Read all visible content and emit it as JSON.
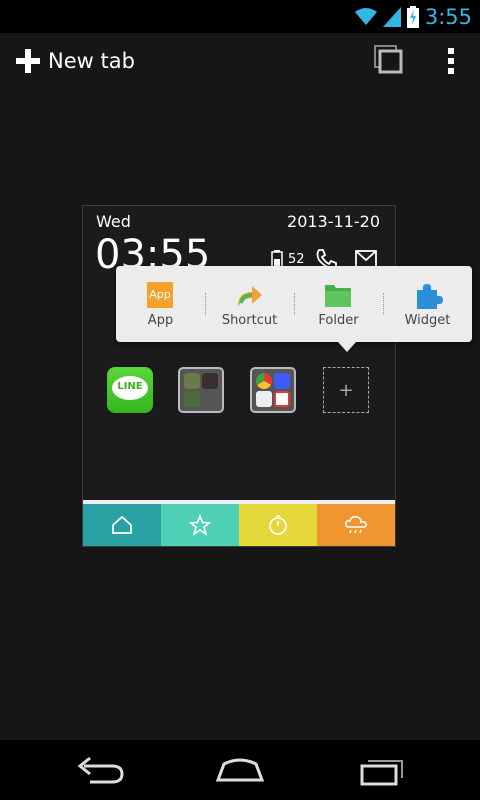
{
  "status_bar": {
    "time": "3:55"
  },
  "action_bar": {
    "new_tab_label": "New tab"
  },
  "preview": {
    "day": "Wed",
    "date": "2013-11-20",
    "clock": "03:55",
    "battery_level": "52",
    "line_app_label": "LINE",
    "dock_colors": [
      "#2aa1a5",
      "#4fd1b8",
      "#e6d83a",
      "#ef9630"
    ]
  },
  "add_menu": {
    "options": [
      {
        "label": "App",
        "icon_text": "App"
      },
      {
        "label": "Shortcut"
      },
      {
        "label": "Folder"
      },
      {
        "label": "Widget"
      }
    ]
  }
}
